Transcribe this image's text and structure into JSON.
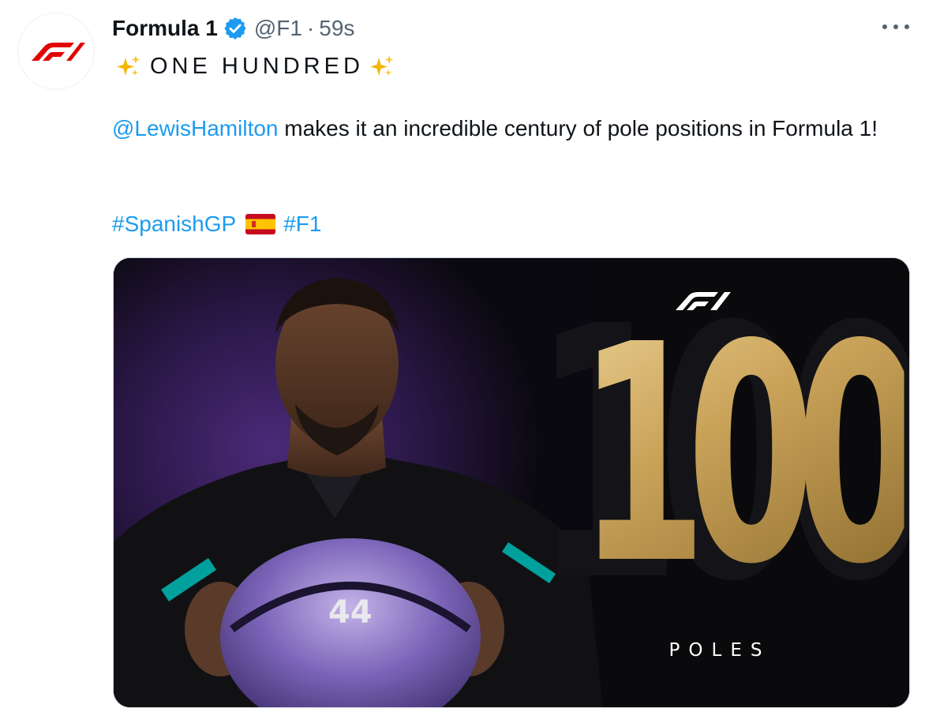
{
  "tweet": {
    "display_name": "Formula 1",
    "handle": "@F1",
    "separator": "·",
    "time": "59s",
    "headline": "ONE HUNDRED",
    "mention": "@LewisHamilton",
    "body_text": " makes it an incredible century of pole positions in Formula 1!",
    "hashtag_1": "#SpanishGP",
    "hashtag_2": "#F1"
  },
  "media": {
    "number": "100",
    "caption": "POLES",
    "car_number": "44",
    "alt_subject": "Lewis Hamilton holding helmet"
  },
  "icons": {
    "avatar": "f1-logo-icon",
    "verified": "verified-badge-icon",
    "more": "more-options-icon",
    "sparkle": "sparkles-icon",
    "flag": "spain-flag-icon"
  },
  "colors": {
    "link": "#1d9bf0",
    "f1_red": "#e10600",
    "verified": "#1d9bf0",
    "gold": "#caa35a",
    "secondary_text": "#536471"
  }
}
